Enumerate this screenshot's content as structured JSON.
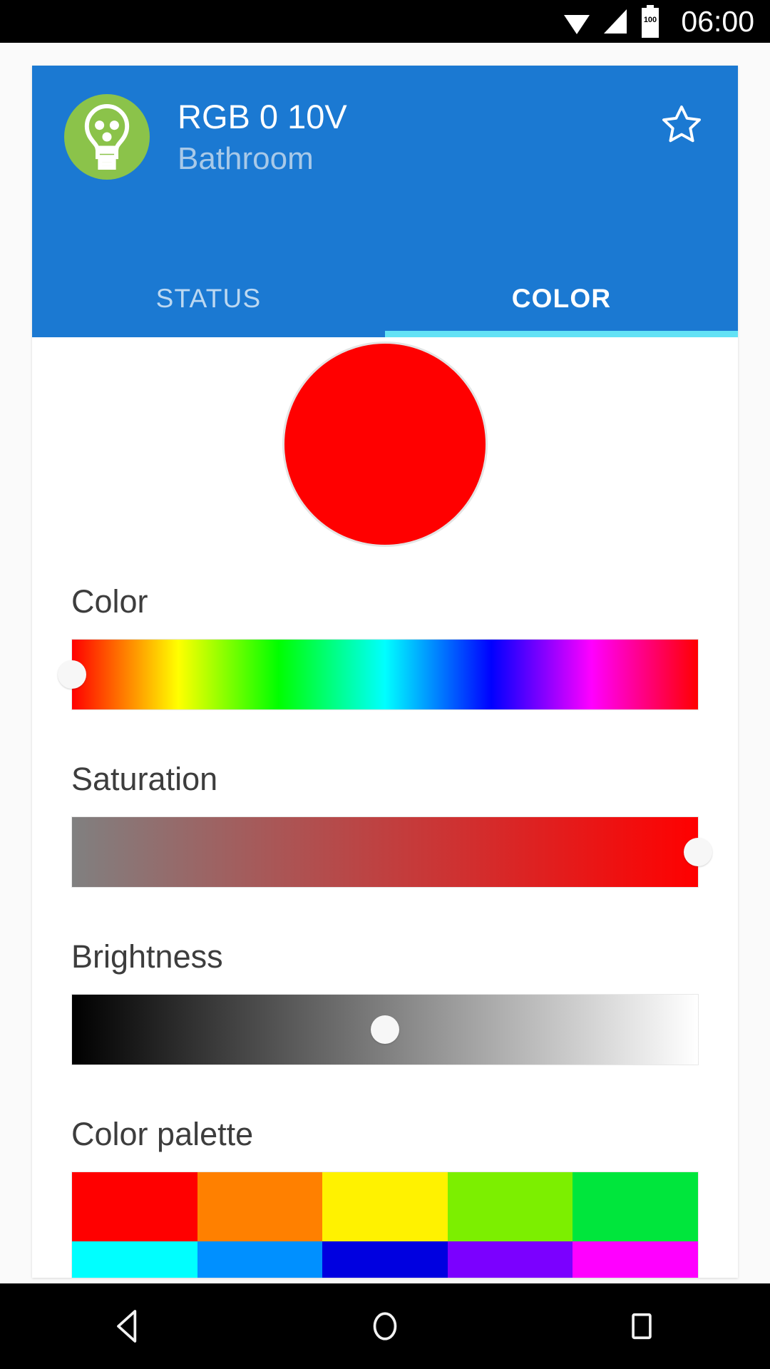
{
  "status_bar": {
    "time": "06:00",
    "battery_level_label": "100",
    "icons": [
      "wifi-icon",
      "signal-icon",
      "battery-icon"
    ]
  },
  "header": {
    "device_name": "RGB 0 10V",
    "room_name": "Bathroom",
    "avatar_icon": "lightbulb-icon",
    "avatar_bg_color": "#8bc34a",
    "favorite_icon": "star-outline-icon",
    "background_color": "#1b79d2"
  },
  "tabs": [
    {
      "label": "STATUS",
      "active": false
    },
    {
      "label": "COLOR",
      "active": true
    }
  ],
  "tab_indicator_color": "#62e2f5",
  "preview": {
    "name": "color-preview-circle",
    "color": "#FF0000"
  },
  "sliders": [
    {
      "label": "Color",
      "name": "hue-slider",
      "value_percent": 0,
      "track_type": "hue-spectrum"
    },
    {
      "label": "Saturation",
      "name": "saturation-slider",
      "value_percent": 100,
      "track_from": "#808080",
      "track_to": "#FF0000"
    },
    {
      "label": "Brightness",
      "name": "brightness-slider",
      "value_percent": 50,
      "track_from": "#000000",
      "track_to": "#FFFFFF"
    }
  ],
  "palette": {
    "label": "Color palette",
    "rows": [
      [
        "#FF0000",
        "#FF8000",
        "#FFF200",
        "#7CEF00",
        "#00E63C"
      ],
      [
        "#00FFFF",
        "#0090FF",
        "#0000E0",
        "#7B00FF",
        "#FF00FF"
      ]
    ]
  },
  "nav_bar": {
    "buttons": [
      {
        "name": "nav-back-button",
        "icon": "back-triangle-icon"
      },
      {
        "name": "nav-home-button",
        "icon": "home-circle-icon"
      },
      {
        "name": "nav-recents-button",
        "icon": "recents-square-icon"
      }
    ]
  }
}
